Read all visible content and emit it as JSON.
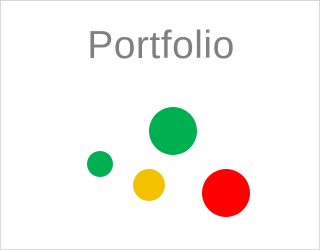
{
  "tile": {
    "title": "Portfolio"
  },
  "indicators": [
    {
      "name": "indicator-dot-large-green",
      "color": "#00b050"
    },
    {
      "name": "indicator-dot-small-green",
      "color": "#00b050"
    },
    {
      "name": "indicator-dot-yellow",
      "color": "#f2c200"
    },
    {
      "name": "indicator-dot-red",
      "color": "#ff0000"
    }
  ]
}
